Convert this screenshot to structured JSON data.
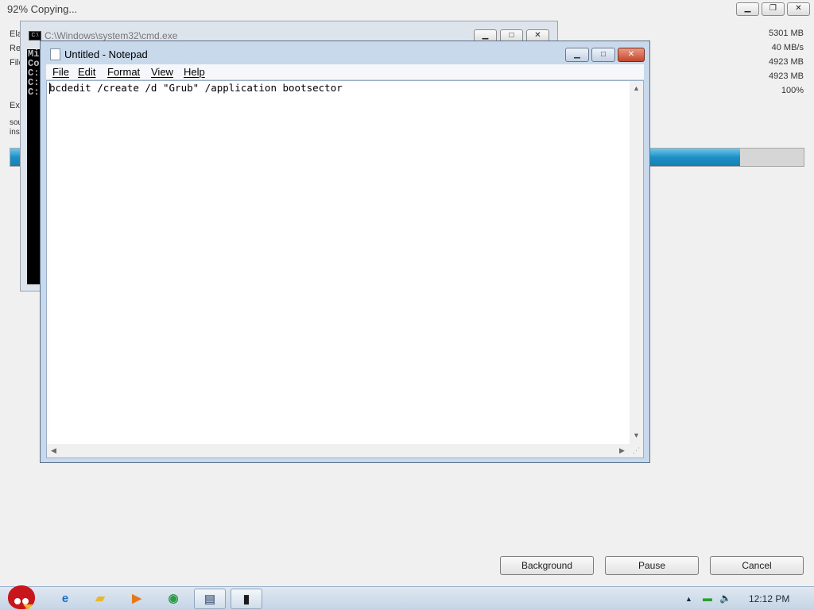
{
  "copy_window": {
    "title": "92% Copying...",
    "progress_fraction": 0.92,
    "left_fragments": [
      "Ela",
      "Re",
      "File",
      "Ext",
      "sou",
      "ins"
    ],
    "stats": [
      "5301 MB",
      "40 MB/s",
      "4923 MB",
      "4923 MB",
      "100%"
    ],
    "buttons": {
      "background": "Background",
      "pause": "Pause",
      "cancel": "Cancel"
    },
    "controls": {
      "minimize": "▁",
      "restore": "❐",
      "close": "✕"
    }
  },
  "cmd_window": {
    "title": "C:\\Windows\\system32\\cmd.exe",
    "icon_text": "C:\\",
    "lines": [
      "Mi",
      "Co",
      "",
      "C:",
      "",
      "C:",
      "",
      "C:"
    ]
  },
  "notepad": {
    "title": "Untitled - Notepad",
    "menu": [
      "File",
      "Edit",
      "Format",
      "View",
      "Help"
    ],
    "content": "bcdedit /create /d \"Grub\" /application bootsector",
    "controls": {
      "minimize": "▁",
      "maximize": "□",
      "close": "✕"
    },
    "scroll_arrows": {
      "up": "▲",
      "down": "▼",
      "left": "◀",
      "right": "▶"
    }
  },
  "taskbar": {
    "start_icon": "angry-bird-icon",
    "items": [
      {
        "name": "internet-explorer-icon",
        "glyph": "e",
        "color": "#1b6ec2"
      },
      {
        "name": "folder-icon",
        "glyph": "▰",
        "color": "#e8b730"
      },
      {
        "name": "media-player-icon",
        "glyph": "▶",
        "color": "#e27a1c"
      },
      {
        "name": "chrome-icon",
        "glyph": "◉",
        "color": "#2c9a46"
      },
      {
        "name": "notepad-icon",
        "glyph": "▤",
        "color": "#5a6f8a"
      },
      {
        "name": "cmd-icon",
        "glyph": "▮",
        "color": "#1a1a1a"
      }
    ],
    "tray": {
      "up_arrow": "▲",
      "network": "▬",
      "volume": "🔈"
    },
    "clock": "12:12 PM"
  }
}
